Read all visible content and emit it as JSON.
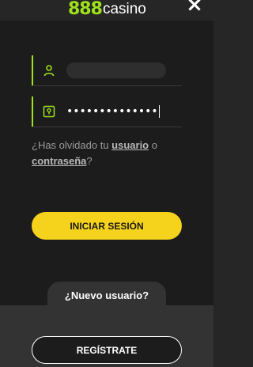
{
  "header": {
    "logo_number": "888",
    "logo_word": "casino",
    "close_label": "×"
  },
  "login": {
    "username_value": "",
    "password_value": "••••••••••••••",
    "forgot_prefix": "¿Has olvidado tu ",
    "forgot_user_link": "usuario",
    "forgot_middle": " o ",
    "forgot_password_link": "contraseña",
    "forgot_suffix": "?",
    "submit_label": "INICIAR SESIÓN"
  },
  "signup": {
    "prompt": "¿Nuevo usuario?",
    "register_label": "REGÍSTRATE"
  },
  "colors": {
    "accent_green": "#9ee21b",
    "button_yellow": "#f5d21b",
    "background": "#1c1c1c"
  },
  "icons": {
    "username_field": "user-icon",
    "password_field": "keyhole-icon",
    "close": "close-icon"
  }
}
